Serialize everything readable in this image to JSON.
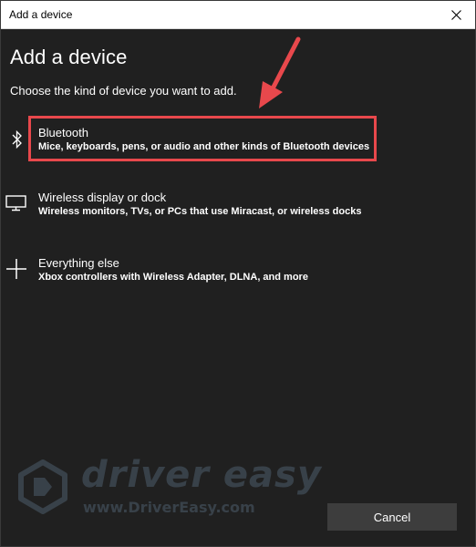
{
  "window": {
    "title": "Add a device"
  },
  "dialog": {
    "heading": "Add a device",
    "subheading": "Choose the kind of device you want to add."
  },
  "options": [
    {
      "title": "Bluetooth",
      "description": "Mice, keyboards, pens, or audio and other kinds of Bluetooth devices",
      "icon": "bluetooth-icon"
    },
    {
      "title": "Wireless display or dock",
      "description": "Wireless monitors, TVs, or PCs that use Miracast, or wireless docks",
      "icon": "monitor-icon"
    },
    {
      "title": "Everything else",
      "description": "Xbox controllers with Wireless Adapter, DLNA, and more",
      "icon": "plus-icon"
    }
  ],
  "buttons": {
    "cancel": "Cancel"
  },
  "watermark": {
    "brand": "driver easy",
    "url": "www.DriverEasy.com"
  },
  "colors": {
    "background": "#202020",
    "highlight": "#e8484c",
    "button": "#3d3d3d",
    "watermark": "#8fb6dc"
  }
}
